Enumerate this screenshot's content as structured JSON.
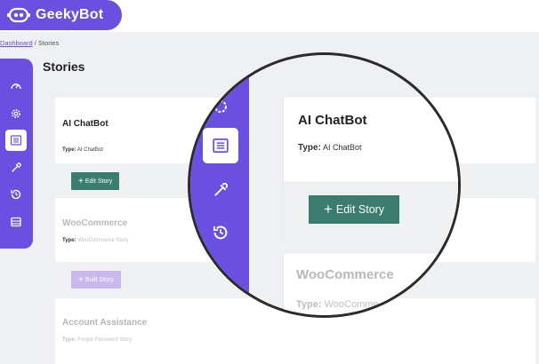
{
  "app": {
    "name": "GeekyBot",
    "brand_color": "#6a4fe0",
    "button_color": "#3a7d6e",
    "disabled_button_color": "#c8b8ee"
  },
  "breadcrumb": {
    "root": "Dashboard",
    "separator": "/",
    "current": "Stories"
  },
  "page": {
    "title": "Stories"
  },
  "sidebar": {
    "items": [
      {
        "icon": "dashboard-gauge-icon"
      },
      {
        "icon": "gear-icon"
      },
      {
        "icon": "list-icon",
        "active": true
      },
      {
        "icon": "eyedropper-icon"
      },
      {
        "icon": "history-icon"
      },
      {
        "icon": "table-icon"
      }
    ]
  },
  "stories": [
    {
      "name": "AI ChatBot",
      "type_label": "Type:",
      "type_value": "AI ChatBot",
      "button": "Edit Story",
      "button_icon": "+"
    },
    {
      "name": "WooCommerce",
      "type_label": "Type:",
      "type_value": "WooCommerce Story",
      "button": "Built Story",
      "button_icon": "+"
    },
    {
      "name": "Account Assistance",
      "type_label": "Type:",
      "type_value": "Forgot Password Story"
    }
  ],
  "magnifier": {
    "card": {
      "name": "AI ChatBot",
      "type_label": "Type:",
      "type_value": "AI ChatBot",
      "button": "Edit Story",
      "button_icon": "+"
    },
    "card2": {
      "name": "WooCommerce",
      "type_label": "Type:",
      "type_value": "WooComme"
    }
  }
}
